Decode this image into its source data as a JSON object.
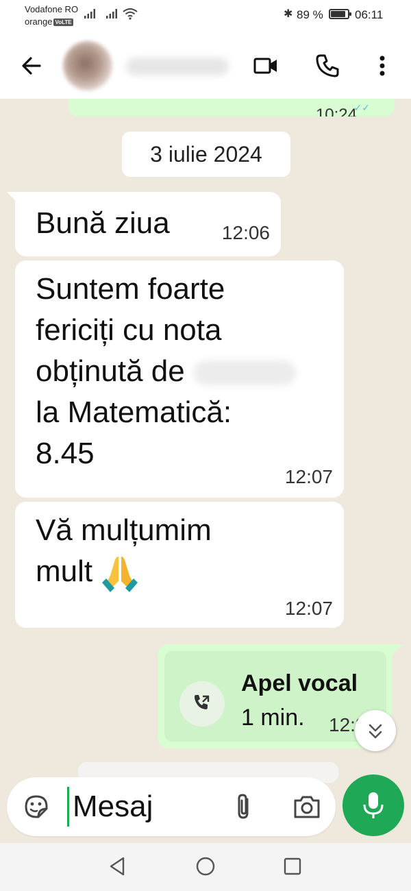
{
  "status": {
    "carrier1": "Vodafone RO",
    "carrier2": "orange",
    "volte": "VoLTE",
    "battery_pct": "89 %",
    "battery_level": 0.89,
    "time": "06:11"
  },
  "header": {
    "back_icon": "arrow-left-icon",
    "video_icon": "video-call-icon",
    "voice_icon": "phone-icon",
    "menu_icon": "more-vertical-icon"
  },
  "chat": {
    "date": "3 iulie 2024",
    "messages": [
      {
        "text": "Bună ziua",
        "time": "12:06"
      },
      {
        "text_lines": [
          "Suntem foarte",
          "fericiți cu nota",
          "obținută de",
          "la Matematică:",
          "8.45"
        ],
        "time": "12:07"
      },
      {
        "text_lines": [
          "Vă mulțumim",
          "mult"
        ],
        "time": "12:07"
      }
    ],
    "call": {
      "title": "Apel vocal",
      "duration": "1 min.",
      "time": "12:21"
    }
  },
  "composer": {
    "placeholder": "Mesaj"
  },
  "colors": {
    "accent": "#1fa855",
    "outgoing": "#d9fdd3",
    "incoming": "#ffffff",
    "wallpaper": "#efe8dd"
  }
}
